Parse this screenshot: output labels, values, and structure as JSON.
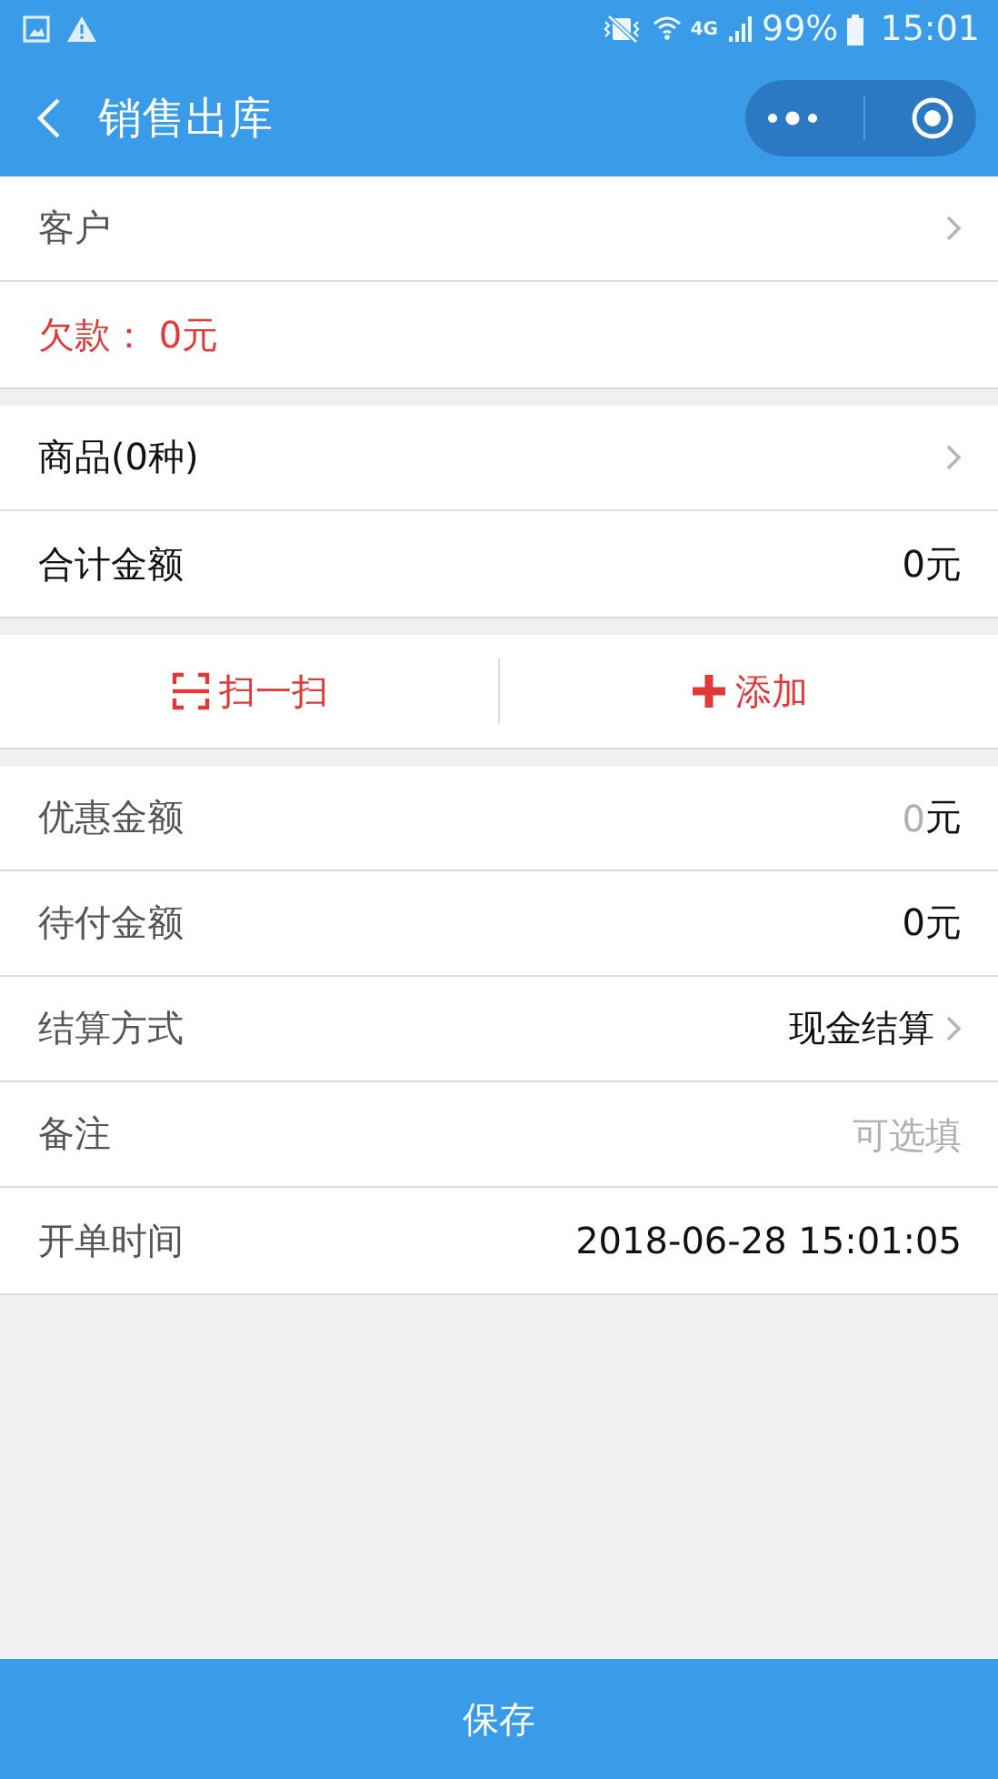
{
  "status_bar": {
    "network": "4G",
    "battery": "99%",
    "time": "15:01"
  },
  "nav_bar": {
    "title": "销售出库"
  },
  "groups": [
    {
      "kind": "rows",
      "rows": [
        {
          "kind": "link",
          "label": "客户",
          "strong": false
        },
        {
          "kind": "notice",
          "text": "欠款： 0元"
        }
      ]
    },
    {
      "kind": "rows",
      "rows": [
        {
          "kind": "link",
          "label": "商品(0种)",
          "strong": true
        },
        {
          "kind": "value",
          "label": "合计金额",
          "value": "0元",
          "strong": true
        }
      ]
    },
    {
      "kind": "actions",
      "actions": [
        {
          "kind": "scan",
          "label": "扫一扫"
        },
        {
          "kind": "add",
          "label": "添加"
        }
      ]
    },
    {
      "kind": "rows",
      "rows": [
        {
          "kind": "amount_input",
          "label": "优惠金额",
          "placeholder": "0",
          "unit": "元",
          "strong": false
        },
        {
          "kind": "value",
          "label": "待付金额",
          "value": "0元",
          "strong": false
        },
        {
          "kind": "link",
          "label": "结算方式",
          "value": "现金结算",
          "strong": false
        },
        {
          "kind": "text_input",
          "label": "备注",
          "placeholder": "可选填",
          "strong": false
        },
        {
          "kind": "value",
          "label": "开单时间",
          "value": "2018-06-28 15:01:05",
          "strong": false
        }
      ]
    }
  ],
  "footer": {
    "save_button": "保存"
  }
}
